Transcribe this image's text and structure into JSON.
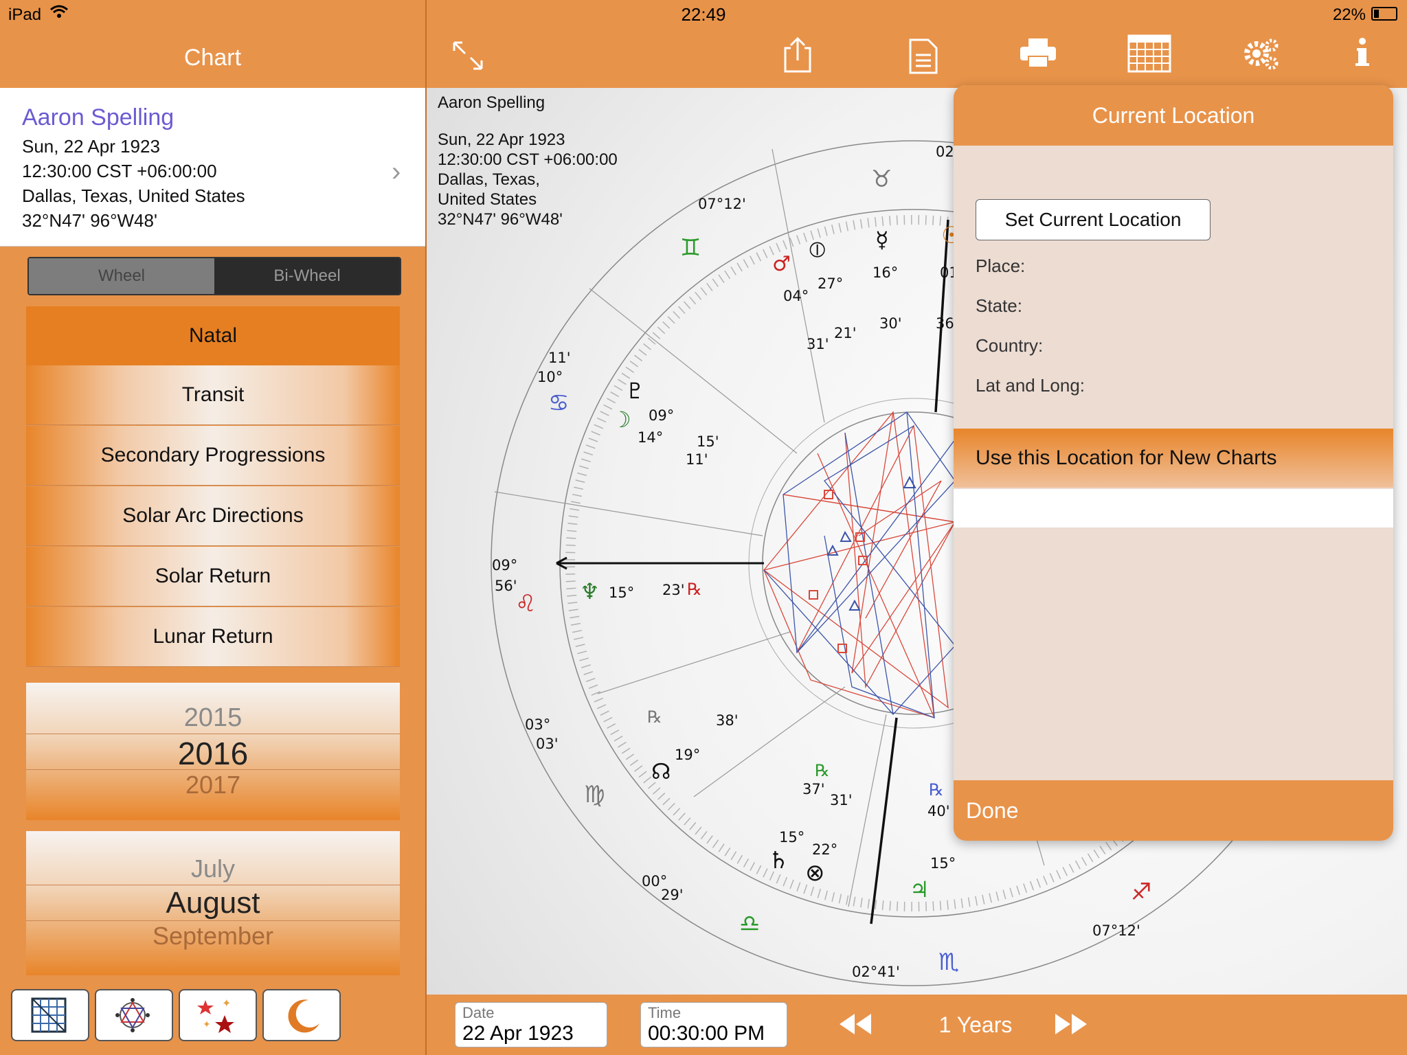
{
  "status": {
    "device": "iPad",
    "time": "22:49",
    "battery": "22%"
  },
  "left": {
    "header": "Chart",
    "person": {
      "name": "Aaron Spelling",
      "date": "Sun, 22 Apr 1923",
      "time": "12:30:00 CST +06:00:00",
      "place": "Dallas, Texas, United States",
      "coords": "32°N47' 96°W48'"
    },
    "segment": [
      "Wheel",
      "Bi-Wheel"
    ],
    "segment_selected": "Bi-Wheel",
    "menu": [
      "Natal",
      "Transit",
      "Secondary Progressions",
      "Solar Arc Directions",
      "Solar Return",
      "Lunar Return"
    ],
    "menu_selected": "Natal",
    "year_picker": [
      "2015",
      "2016",
      "2017"
    ],
    "month_picker": [
      "July",
      "August",
      "September"
    ],
    "bottom_buttons": [
      "grid-icon",
      "aspect-wheel-icon",
      "stars-icon",
      "moon-icon"
    ]
  },
  "chart_info": {
    "name": "Aaron Spelling",
    "date": "Sun, 22 Apr 1923",
    "time": "12:30:00 CST +06:00:00",
    "city": "Dallas, Texas,",
    "country": "United States",
    "coords": "32°N47' 96°W48'"
  },
  "wheel": {
    "ascendant_deg": "09°",
    "ascendant_min": "56'",
    "cusp_cancer_deg": "10°",
    "cusp_cancer_min": "11'",
    "cusp_gemini": "07°12'",
    "cusp_virgo_deg": "03°",
    "cusp_virgo_min": "03'",
    "cusp_libra_deg": "00°",
    "cusp_libra_min": "29'",
    "cusp_bottom": "02°41'",
    "cusp_right": "07°12'",
    "cusp_top": "02",
    "planets": {
      "mars": "04°",
      "mars_min": "31'",
      "pof": "27°",
      "pof_min": "21'",
      "mercury": "16°",
      "mercury_min": "30'",
      "pluto": "09°",
      "pluto_min": "15'",
      "moon": "14°",
      "moon_min": "11'",
      "neptune": "15°",
      "neptune_min": "23'",
      "node": "19°",
      "node_min": "38'",
      "saturn": "15°",
      "saturn_min": "37'",
      "vertex": "22°",
      "vertex_min": "31'",
      "jupiter": "15°",
      "jupiter_min": "40'",
      "sun_partial": "01",
      "sun_partial_min": "36"
    },
    "retro": "℞"
  },
  "bottom_bar": {
    "date_label": "Date",
    "date_value": "22 Apr 1923",
    "time_label": "Time",
    "time_value": "00:30:00 PM",
    "step": "1 Years"
  },
  "popover": {
    "title": "Current Location",
    "set_button": "Set Current Location",
    "place": "Place:",
    "state": "State:",
    "country": "Country:",
    "latlong": "Lat and Long:",
    "use_button": "Use this Location for New Charts",
    "done": "Done"
  },
  "colors": {
    "accent": "#e8934a",
    "selected": "#e67f22",
    "name": "#6a5bd2",
    "aspect_red": "#d9483b",
    "aspect_blue": "#3b54a8"
  }
}
